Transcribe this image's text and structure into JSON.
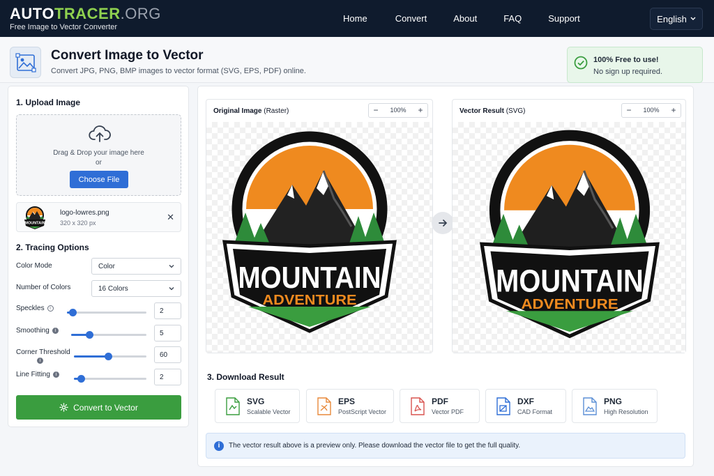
{
  "brand": {
    "part1": "AUTO",
    "part2": "TRACER",
    "part3": ".ORG",
    "tagline": "Free Image to Vector Converter"
  },
  "nav": {
    "items": [
      "Home",
      "Convert",
      "About",
      "FAQ",
      "Support"
    ],
    "language": "English"
  },
  "header": {
    "title": "Convert Image to Vector",
    "subtitle": "Convert JPG, PNG, BMP images to vector format (SVG, EPS, PDF) online.",
    "free_title": "100% Free to use!",
    "free_sub": "No sign up required."
  },
  "upload": {
    "section_title": "1. Upload Image",
    "drop_text": "Drag & Drop your image here",
    "or_text": "or",
    "choose_label": "Choose File",
    "file_name": "logo-lowres.png",
    "file_dims": "320 x 320 px"
  },
  "options": {
    "section_title": "2. Tracing Options",
    "color_mode_label": "Color Mode",
    "color_mode_value": "Color",
    "num_colors_label": "Number of Colors",
    "num_colors_value": "16 Colors",
    "speckles_label": "Speckles",
    "speckles_value": "2",
    "speckles_level": 0.07,
    "smoothing_label": "Smoothing",
    "smoothing_value": "5",
    "smoothing_level": 0.24,
    "corner_label": "Corner Threshold",
    "corner_value": "60",
    "corner_level": 0.47,
    "line_label": "Line Fitting",
    "line_value": "2",
    "line_level": 0.1,
    "convert_label": "Convert to Vector"
  },
  "preview": {
    "original_title_bold": "Original Image",
    "original_title_rest": " (Raster)",
    "original_zoom": "100%",
    "vector_title_bold": "Vector Result",
    "vector_title_rest": " (SVG)",
    "vector_zoom": "100%",
    "logo_line1": "MOUNTAIN",
    "logo_line2": "ADVENTURE"
  },
  "download": {
    "section_title": "3. Download Result",
    "formats": [
      {
        "name": "SVG",
        "sub": "Scalable Vector",
        "color": "#3a9d3f"
      },
      {
        "name": "EPS",
        "sub": "PostScript Vector",
        "color": "#e8893a"
      },
      {
        "name": "PDF",
        "sub": "Vector PDF",
        "color": "#d9534f"
      },
      {
        "name": "DXF",
        "sub": "CAD Format",
        "color": "#2f6ed6"
      },
      {
        "name": "PNG",
        "sub": "High Resolution",
        "color": "#5b8fd6"
      }
    ],
    "notice": "The vector result above is a preview only. Please download the vector file to get the full quality."
  },
  "colors": {
    "accent_blue": "#2f6ed6",
    "accent_green": "#3a9d3f",
    "nav_bg": "#0f1b2d",
    "logo_orange": "#ef8a1f"
  }
}
